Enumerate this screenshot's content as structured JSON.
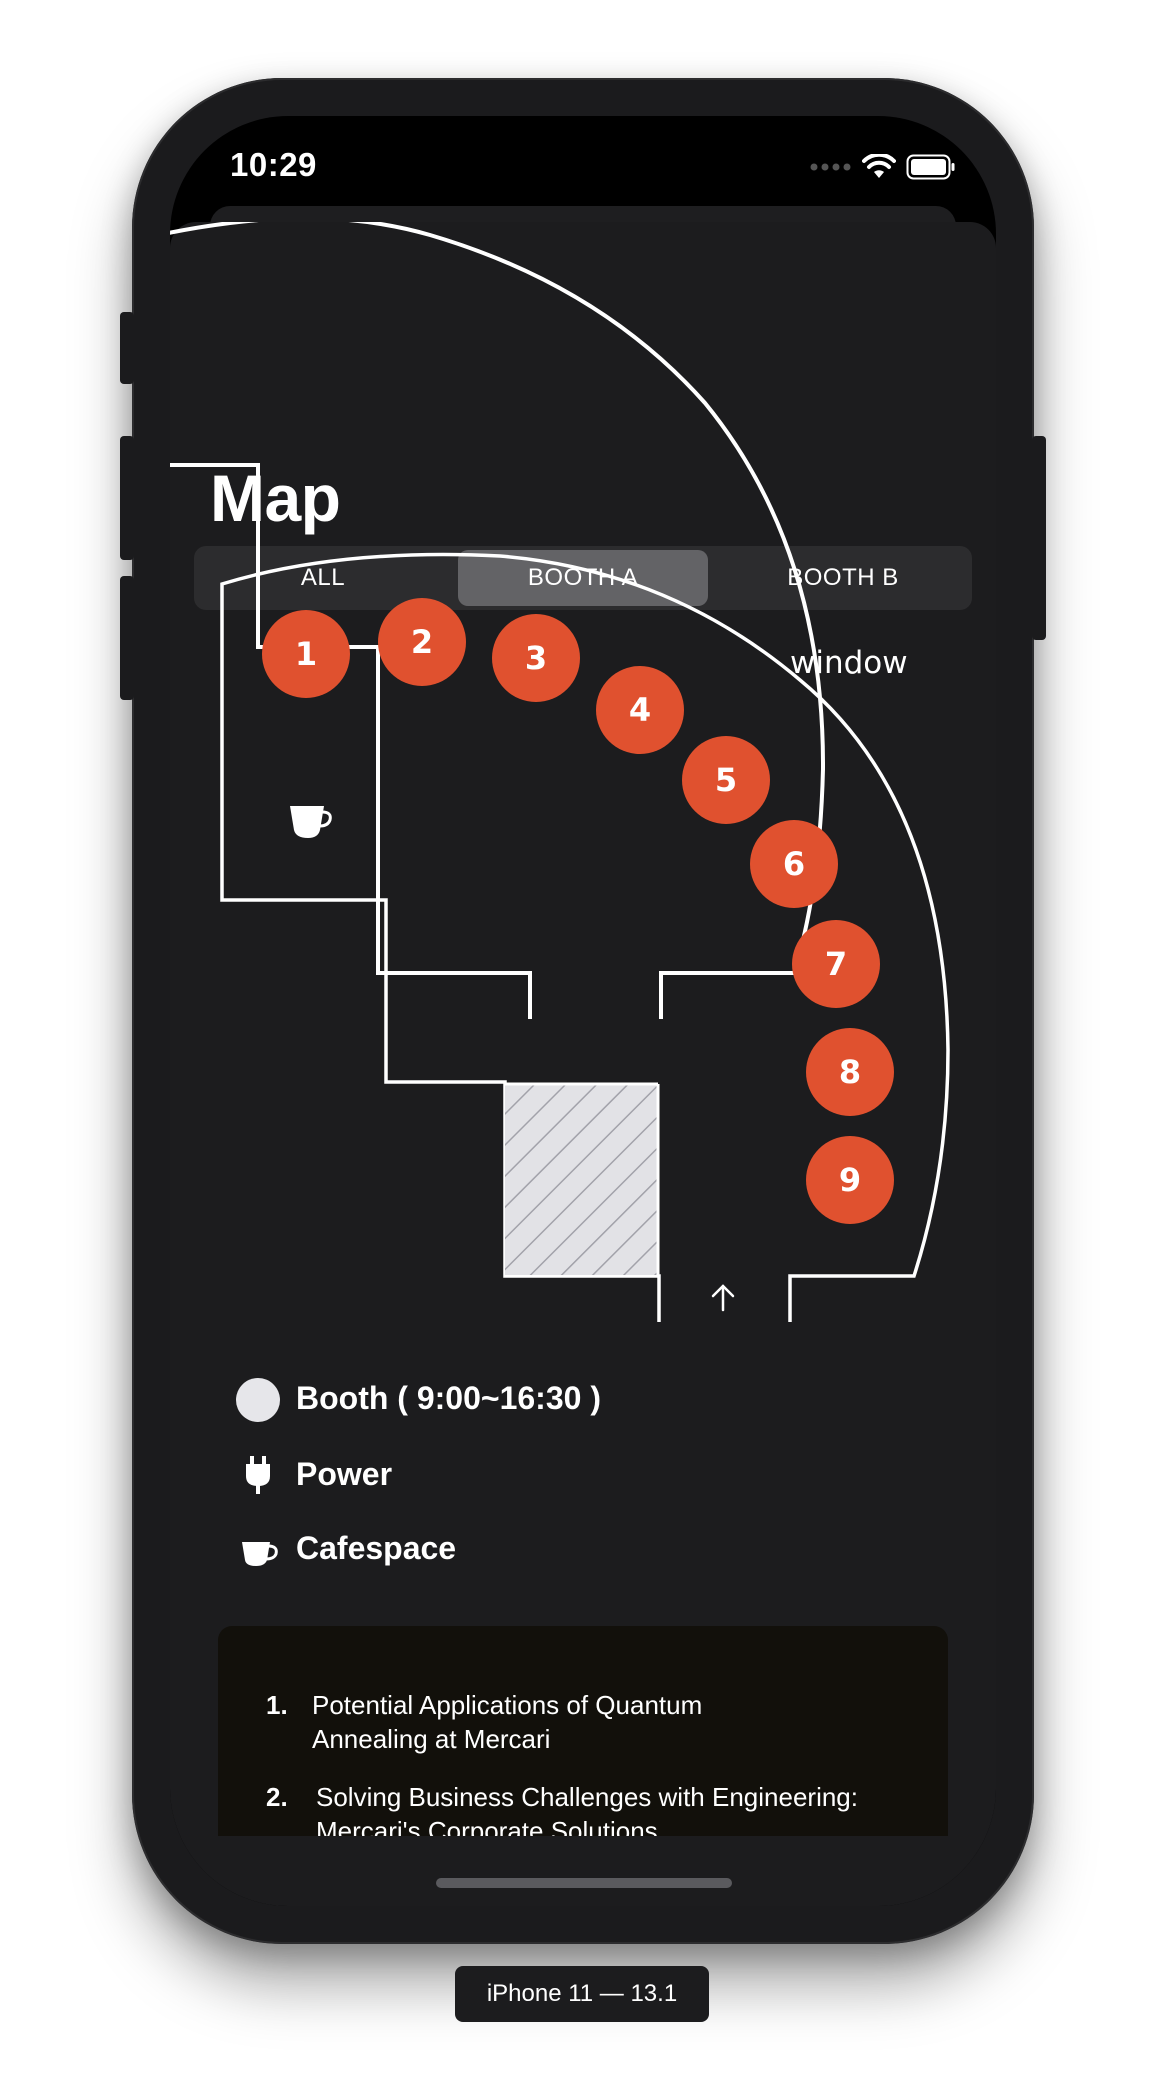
{
  "status_bar": {
    "time": "10:29"
  },
  "page": {
    "title": "Map"
  },
  "tabs": [
    {
      "label": "ALL",
      "selected": false
    },
    {
      "label": "BOOTH A",
      "selected": true
    },
    {
      "label": "BOOTH B",
      "selected": false
    }
  ],
  "map": {
    "window_label": "window",
    "booths": [
      "1",
      "2",
      "3",
      "4",
      "5",
      "6",
      "7",
      "8",
      "9"
    ],
    "booth_color": "#e0512f",
    "wall_color": "#ffffff"
  },
  "legend": {
    "booth": "Booth ( 9:00~16:30 )",
    "power": "Power",
    "cafe": "Cafespace"
  },
  "sessions": [
    {
      "number": "1.",
      "title": "Potential Applications of Quantum Annealing at Mercari"
    },
    {
      "number": "2.",
      "title": "Solving Business Challenges with Engineering: Mercari's Corporate Solutions"
    }
  ],
  "device_label": "iPhone 11 — 13.1"
}
